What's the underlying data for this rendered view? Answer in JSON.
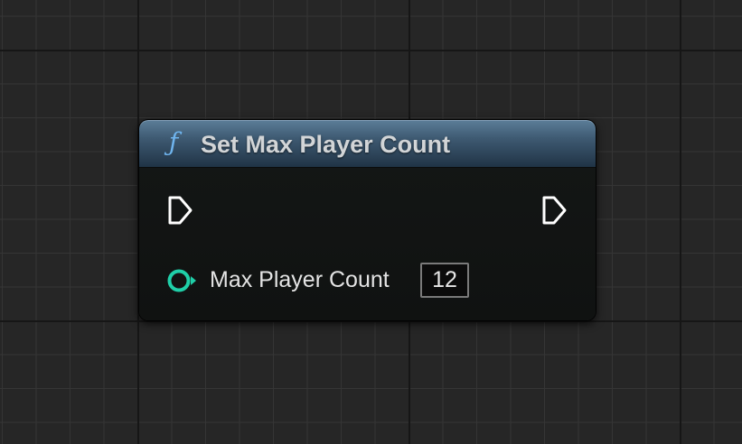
{
  "node": {
    "title": "Set Max Player Count",
    "icon": "function-icon",
    "icon_glyph": "ƒ",
    "header_color": "#3e5a72",
    "pins": {
      "exec_in": "exec-input-pin",
      "exec_out": "exec-output-pin",
      "input": {
        "label": "Max Player Count",
        "value": "12",
        "type_color": "#1fcfa8"
      }
    }
  }
}
